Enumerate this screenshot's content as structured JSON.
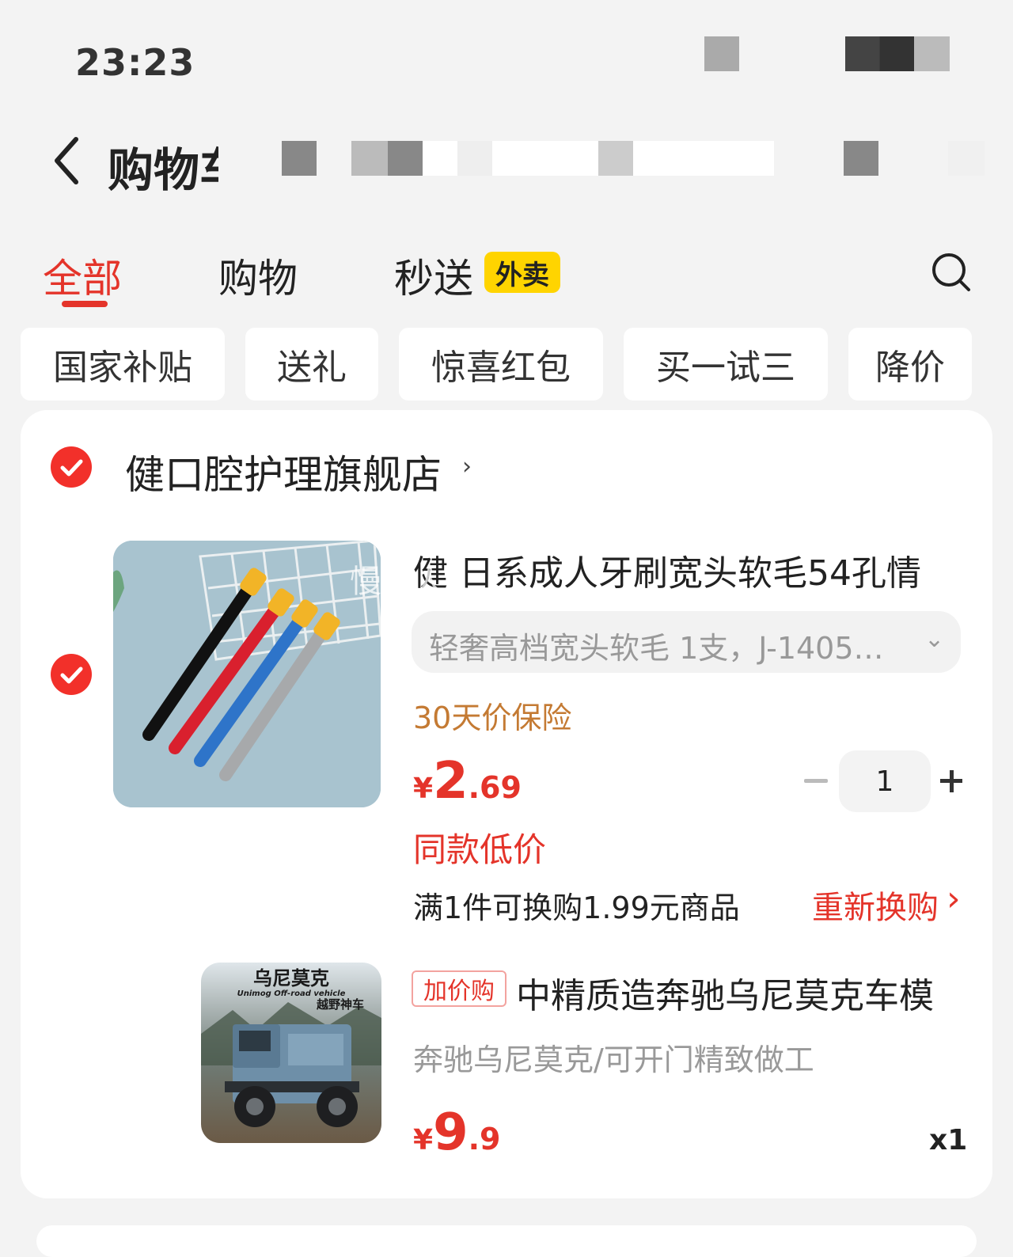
{
  "status_bar": {
    "time": "23:23"
  },
  "header": {
    "title": "购物车"
  },
  "tabs": [
    {
      "label": "全部",
      "active": true
    },
    {
      "label": "购物",
      "active": false
    },
    {
      "label": "秒送",
      "active": false,
      "badge": "外卖"
    }
  ],
  "filters": [
    "国家补贴",
    "送礼",
    "惊喜红包",
    "买一试三",
    "降价"
  ],
  "store": {
    "name": "健口腔护理旗舰店",
    "checked": true
  },
  "item": {
    "checked": true,
    "title": "健 日系成人牙刷宽头软毛54孔情",
    "watermark": "慢星人",
    "sku": "轻奢高档宽头软毛 1支，J-1405…",
    "insurance": "30天价保险",
    "price": {
      "currency": "¥",
      "integer": "2",
      "decimal": ".69"
    },
    "low_price_label": "同款低价",
    "quantity": "1",
    "swap_note": "满1件可换购1.99元商品",
    "reswap_label": "重新换购"
  },
  "addon": {
    "tag": "加价购",
    "title": "中精质造奔驰乌尼莫克车模",
    "subtitle": "奔驰乌尼莫克/可开门精致做工",
    "price": {
      "currency": "¥",
      "integer": "9",
      "decimal": ".9"
    },
    "qty_label": "x1",
    "image_text": {
      "title": "乌尼莫克",
      "sub": "Unimog Off-road vehicle",
      "tag": "越野神车"
    }
  },
  "colors": {
    "accent": "#e4342a",
    "badge": "#ffd400",
    "insurance": "#c47a33"
  }
}
